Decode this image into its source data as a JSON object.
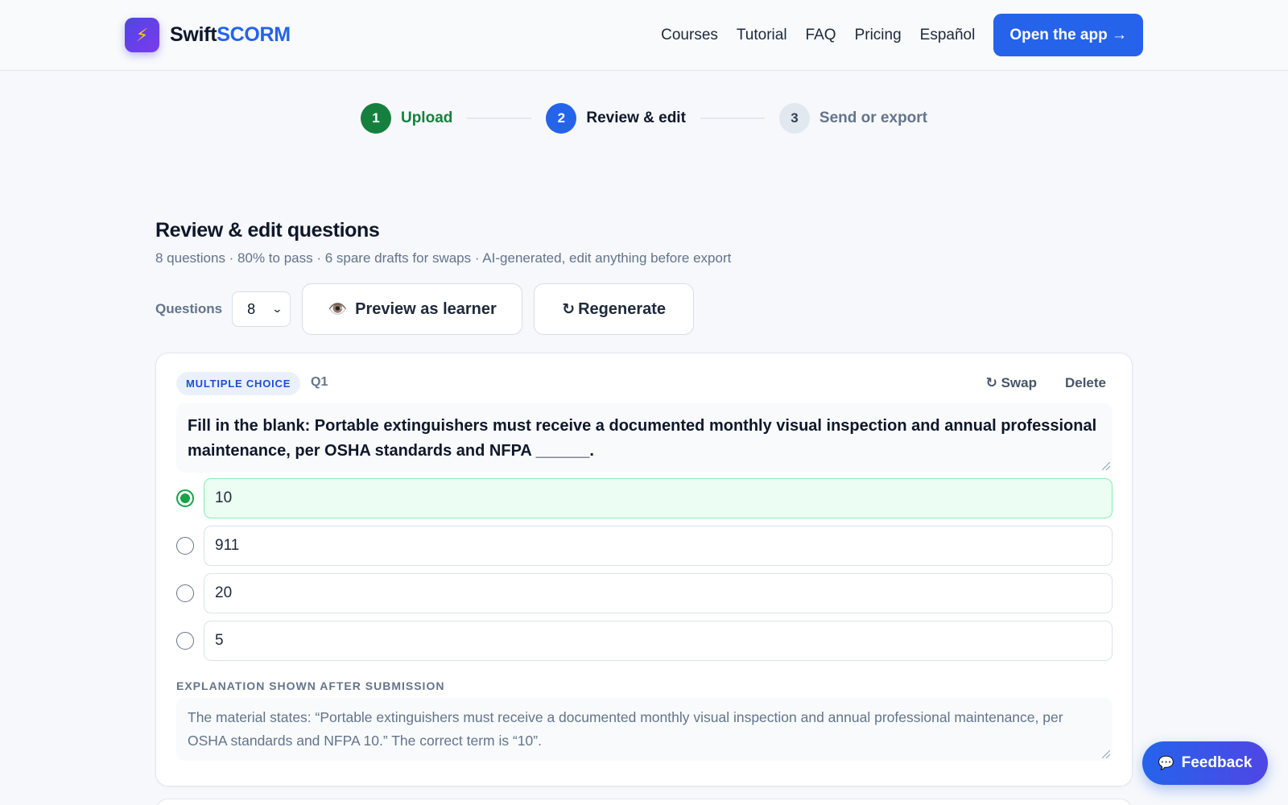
{
  "brand": {
    "name_part1": "Swift",
    "name_part2": "SCORM",
    "logo_icon": "lightning-icon"
  },
  "nav": {
    "items": [
      "Courses",
      "Tutorial",
      "FAQ",
      "Pricing",
      "Español"
    ],
    "cta": "Open the app →"
  },
  "stepper": {
    "steps": [
      {
        "num": "1",
        "label": "Upload",
        "state": "done"
      },
      {
        "num": "2",
        "label": "Review & edit",
        "state": "active"
      },
      {
        "num": "3",
        "label": "Send or export",
        "state": "todo"
      }
    ]
  },
  "main": {
    "title": "Review & edit questions",
    "subtitle": "8 questions · 80% to pass · 6 spare drafts for swaps · AI-generated, edit anything before export",
    "toolbar": {
      "questions_label": "Questions",
      "questions_value": "8",
      "preview_icon": "👁️",
      "preview_label": "Preview as learner",
      "regen_icon": "↻",
      "regen_label": "Regenerate"
    }
  },
  "question": {
    "type_badge": "MULTIPLE CHOICE",
    "number": "Q1",
    "swap_label": "↻ Swap",
    "delete_label": "Delete",
    "text": "Fill in the blank: Portable extinguishers must receive a documented monthly visual inspection and annual professional maintenance, per OSHA standards and NFPA ______.",
    "options": [
      {
        "value": "10",
        "correct": true
      },
      {
        "value": "911",
        "correct": false
      },
      {
        "value": "20",
        "correct": false
      },
      {
        "value": "5",
        "correct": false
      }
    ],
    "explanation_label": "EXPLANATION SHOWN AFTER SUBMISSION",
    "explanation": "The material states: “Portable extinguishers must receive a documented monthly visual inspection and annual professional maintenance, per OSHA standards and NFPA 10.” The correct term is “10”."
  },
  "feedback": {
    "icon": "💬",
    "label": "Feedback"
  },
  "colors": {
    "primary": "#2563eb",
    "success": "#15803d",
    "muted": "#64748b"
  }
}
